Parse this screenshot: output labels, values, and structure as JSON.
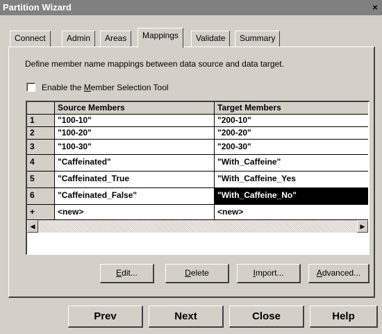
{
  "window": {
    "title": "Partition Wizard",
    "close_glyph": "×"
  },
  "tabs": [
    {
      "label": "Connect",
      "active": false
    },
    {
      "label": "Admin",
      "active": false
    },
    {
      "label": "Areas",
      "active": false
    },
    {
      "label": "Mappings",
      "active": true
    },
    {
      "label": "Validate",
      "active": false
    },
    {
      "label": "Summary",
      "active": false
    }
  ],
  "description": "Define member name mappings between data source and data target.",
  "checkbox": {
    "label_pre": "Enable the ",
    "label_accel": "M",
    "label_post": "ember Selection Tool",
    "checked": false
  },
  "grid": {
    "columns": [
      "Source Members",
      "Target Members"
    ],
    "rows": [
      {
        "idx": "1",
        "source": "\"100-10\"",
        "target": "\"200-10\""
      },
      {
        "idx": "2",
        "source": "\"100-20\"",
        "target": "\"200-20\""
      },
      {
        "idx": "3",
        "source": "\"100-30\"",
        "target": "\"200-30\""
      },
      {
        "idx": "4",
        "source": "\"Caffeinated\"",
        "target": "\"With_Caffeine\""
      },
      {
        "idx": "5",
        "source": "\"Caffeinated_True",
        "target": "\"With_Caffeine_Yes"
      },
      {
        "idx": "6",
        "source": "\"Caffeinated_False\"",
        "target": "\"With_Caffeine_No\""
      },
      {
        "idx": "+",
        "source": "<new>",
        "target": "<new>"
      }
    ]
  },
  "buttons": {
    "edit": {
      "accel": "E",
      "rest": "dit..."
    },
    "delete": {
      "accel": "D",
      "rest": "elete"
    },
    "import": {
      "accel": "I",
      "rest": "mport..."
    },
    "advanced": {
      "accel": "A",
      "rest": "dvanced..."
    }
  },
  "nav": {
    "prev": "Prev",
    "next": "Next",
    "close": "Close",
    "help": "Help"
  },
  "icons": {
    "scroll_left": "◀",
    "scroll_right": "▶"
  }
}
